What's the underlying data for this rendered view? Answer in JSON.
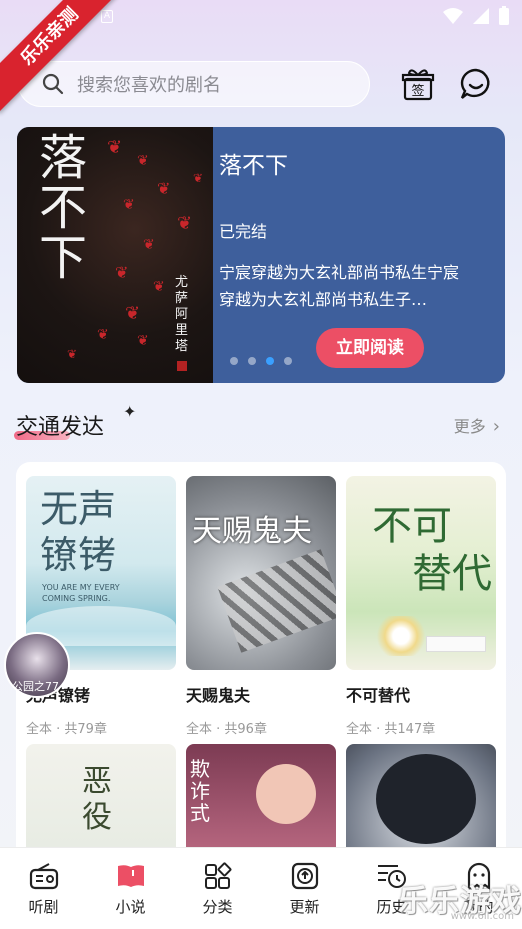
{
  "watermark": {
    "ribbon": "乐乐亲测",
    "brand": "乐乐游戏",
    "url": "www.6ll.com"
  },
  "status_bar": {
    "notification_letter": "A"
  },
  "search": {
    "placeholder": "搜索您喜欢的剧名"
  },
  "top_icons": {
    "sign_in_glyph": "签",
    "sign_in_icon": "gift-sign-in-icon",
    "message_icon": "chat-bubble-icon"
  },
  "banner": {
    "cover_title": "落不下",
    "cover_author": "尤萨阿里塔",
    "title": "落不下",
    "status": "已完结",
    "description": "宁宸穿越为大玄礼部尚书私生宁宸穿越为大玄礼部尚书私生子…",
    "button_label": "立即阅读",
    "dots_count": 4,
    "active_dot": 2
  },
  "section": {
    "title": "交通发达",
    "more_label": "更多"
  },
  "books": [
    {
      "title": "无声镣铐",
      "meta": "全本 · 共79章",
      "cover_text": "无声\n镣铐",
      "cover_subtext": "YOU ARE MY EVERY\nCOMING SPRING."
    },
    {
      "title": "天赐鬼夫",
      "meta": "全本 · 共96章",
      "cover_text": "天赐鬼夫"
    },
    {
      "title": "不可替代",
      "meta": "全本 · 共147章",
      "cover_text": "不可\n替代"
    }
  ],
  "books_row2": [
    {
      "cover_text": "恶役"
    },
    {
      "cover_text": "欺诈式"
    },
    {
      "cover_text": ""
    }
  ],
  "floating_avatar": {
    "label": "公园之77"
  },
  "bottom_nav": [
    {
      "label": "听剧",
      "icon": "radio-icon"
    },
    {
      "label": "小说",
      "icon": "book-icon",
      "active": true
    },
    {
      "label": "分类",
      "icon": "category-grid-icon"
    },
    {
      "label": "更新",
      "icon": "update-icon"
    },
    {
      "label": "历史",
      "icon": "history-icon"
    },
    {
      "label": "我的",
      "icon": "profile-ghost-icon"
    }
  ],
  "colors": {
    "accent": "#ec4f65",
    "banner_bg": "#3e5f9c",
    "dot_active": "#3aa0ff"
  }
}
